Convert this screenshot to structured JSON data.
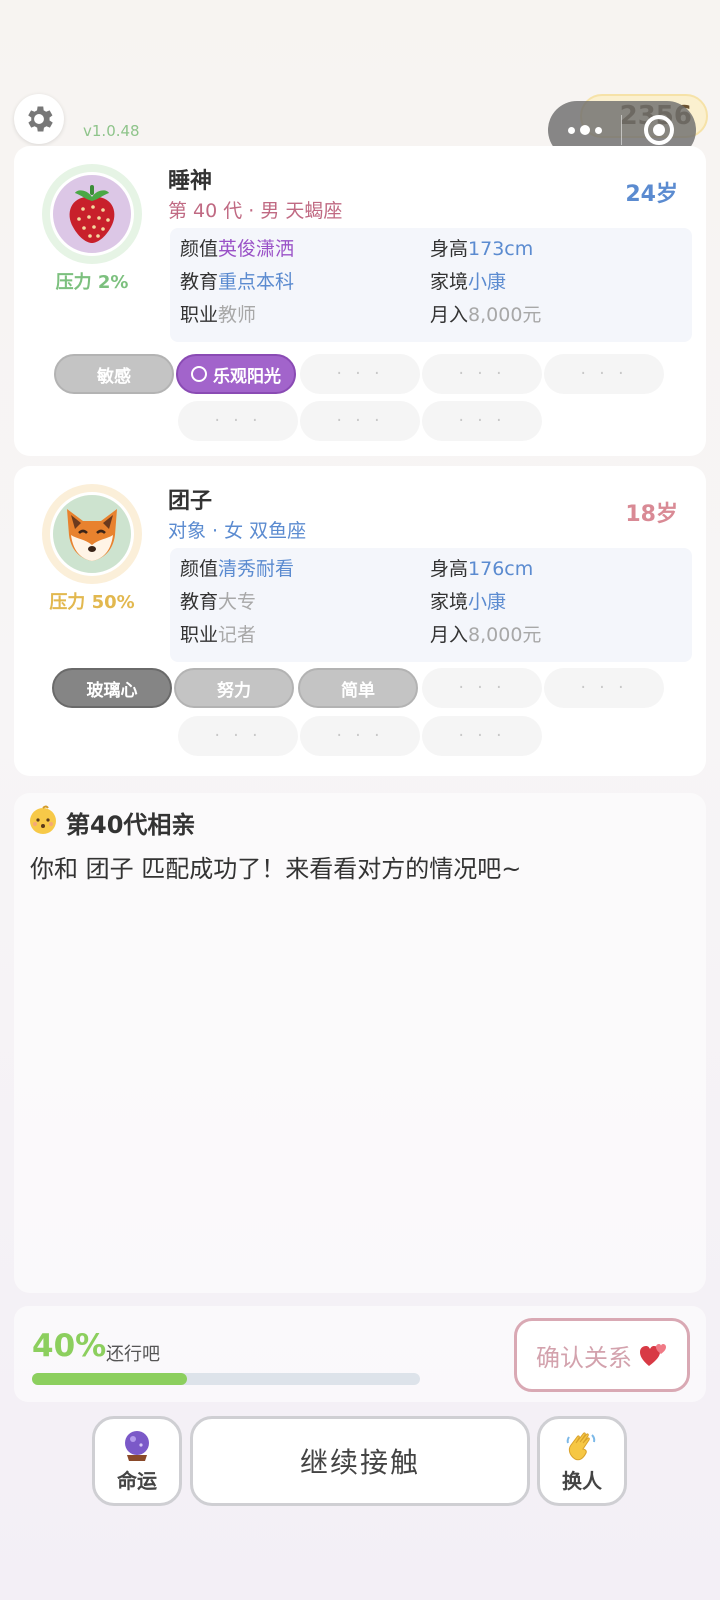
{
  "app": {
    "version": "v1.0.48",
    "coins": "2356"
  },
  "player": {
    "name": "睡神",
    "sub": "第 40 代 · 男 天蝎座",
    "age": "24岁",
    "pressure": "压力 2%",
    "avatar_icon": "strawberry-icon",
    "stats": {
      "looks_label": "颜值",
      "looks": "英俊潇洒",
      "height_label": "身高",
      "height": "173cm",
      "edu_label": "教育",
      "edu": "重点本科",
      "family_label": "家境",
      "family": "小康",
      "job_label": "职业",
      "job": "教师",
      "income_label": "月入",
      "income": "8,000元"
    },
    "tags": [
      "敏感",
      "乐观阳光",
      "· · ·",
      "· · ·",
      "· · ·",
      "· · ·",
      "· · ·",
      "· · ·"
    ]
  },
  "partner": {
    "name": "团子",
    "sub": "对象 · 女 双鱼座",
    "age": "18岁",
    "pressure": "压力 50%",
    "avatar_icon": "fox-icon",
    "stats": {
      "looks_label": "颜值",
      "looks": "清秀耐看",
      "height_label": "身高",
      "height": "176cm",
      "edu_label": "教育",
      "edu": "大专",
      "family_label": "家境",
      "family": "小康",
      "job_label": "职业",
      "job": "记者",
      "income_label": "月入",
      "income": "8,000元"
    },
    "tags": [
      "玻璃心",
      "努力",
      "简单",
      "· · ·",
      "· · ·",
      "· · ·",
      "· · ·",
      "· · ·"
    ]
  },
  "log": {
    "title": "第40代相亲",
    "message": "你和 团子 匹配成功了！来看看对方的情况吧~"
  },
  "progress": {
    "percent_text": "40%",
    "value": 0.4,
    "label": "还行吧",
    "confirm_label": "确认关系"
  },
  "actions": {
    "fate_label": "命运",
    "continue_label": "继续接触",
    "switch_label": "换人"
  },
  "colors": {
    "accent_green": "#8ccf5e",
    "player_age": "#5b8bd0",
    "partner_age": "#d98a95",
    "tag_purple": "#a264cb"
  }
}
